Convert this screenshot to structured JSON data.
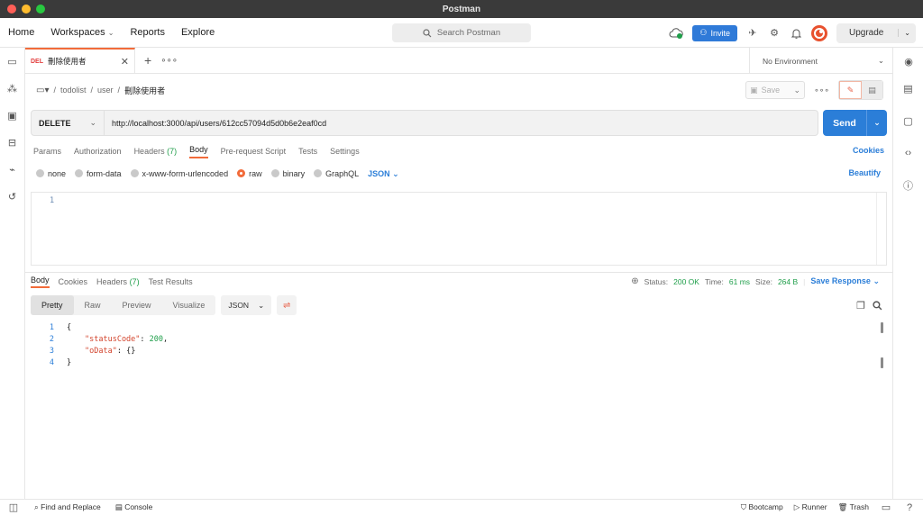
{
  "window": {
    "title": "Postman",
    "traffic": [
      "#ff5f57",
      "#febc2e",
      "#28c840"
    ]
  },
  "header": {
    "nav": [
      "Home",
      "Workspaces",
      "Reports",
      "Explore"
    ],
    "search_placeholder": "Search Postman",
    "invite_label": "Invite",
    "upgrade_label": "Upgrade",
    "accent": "#2f7ad8"
  },
  "tabs": {
    "request": {
      "method": "DEL",
      "name": "刪除使用者"
    },
    "environment": "No Environment"
  },
  "breadcrumb": {
    "items": [
      "todolist",
      "user"
    ],
    "current": "刪除使用者",
    "save_label": "Save"
  },
  "request": {
    "method": "DELETE",
    "url": "http://localhost:3000/api/users/612cc57094d5d0b6e2eaf0cd",
    "send_label": "Send",
    "tabs": [
      {
        "label": "Params",
        "count": ""
      },
      {
        "label": "Authorization",
        "count": ""
      },
      {
        "label": "Headers",
        "count": "(7)"
      },
      {
        "label": "Body",
        "count": ""
      },
      {
        "label": "Pre-request Script",
        "count": ""
      },
      {
        "label": "Tests",
        "count": ""
      },
      {
        "label": "Settings",
        "count": ""
      }
    ],
    "active_tab": "Body",
    "cookies_label": "Cookies",
    "body_options": [
      "none",
      "form-data",
      "x-www-form-urlencoded",
      "raw",
      "binary",
      "GraphQL"
    ],
    "body_selected": "raw",
    "body_format": "JSON",
    "beautify_label": "Beautify",
    "editor_line": "1"
  },
  "response": {
    "tabs": [
      {
        "label": "Body",
        "count": ""
      },
      {
        "label": "Cookies",
        "count": ""
      },
      {
        "label": "Headers",
        "count": "(7)"
      },
      {
        "label": "Test Results",
        "count": ""
      }
    ],
    "status_label": "Status:",
    "status": "200 OK",
    "time_label": "Time:",
    "time": "61 ms",
    "size_label": "Size:",
    "size": "264 B",
    "save_response": "Save Response",
    "views": [
      "Pretty",
      "Raw",
      "Preview",
      "Visualize"
    ],
    "format": "JSON",
    "code_lines": [
      {
        "n": "1",
        "text": "{"
      },
      {
        "n": "2",
        "key": "\"statusCode\"",
        "sep": ": ",
        "val": "200",
        "end": ","
      },
      {
        "n": "3",
        "key": "\"oData\"",
        "sep": ": ",
        "val": "{}",
        "end": ""
      },
      {
        "n": "4",
        "text": "}"
      }
    ]
  },
  "statusbar": {
    "left": [
      "Find and Replace",
      "Console"
    ],
    "right": [
      "Bootcamp",
      "Runner",
      "Trash"
    ]
  }
}
